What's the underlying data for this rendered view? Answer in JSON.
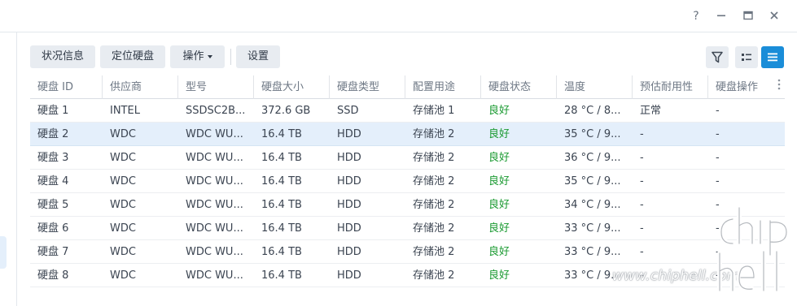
{
  "window": {
    "help_icon": "help-icon",
    "minimize_icon": "minimize-icon",
    "maximize_icon": "maximize-icon",
    "close_icon": "close-icon"
  },
  "toolbar": {
    "status_info_label": "状况信息",
    "locate_disk_label": "定位硬盘",
    "action_label": "操作",
    "settings_label": "设置",
    "filter_icon": "filter-icon",
    "detail_view_icon": "detail-view-icon",
    "list_view_icon": "list-view-icon"
  },
  "colors": {
    "accent": "#1a8dd8",
    "status_good": "#1a9a31",
    "selected_row": "#e4effb"
  },
  "table": {
    "columns": [
      "硬盘 ID",
      "供应商",
      "型号",
      "硬盘大小",
      "硬盘类型",
      "配置用途",
      "硬盘状态",
      "温度",
      "预估耐用性",
      "硬盘操作"
    ],
    "selected_row": 1,
    "rows": [
      [
        "硬盘 1",
        "INTEL",
        "SSDSC2B...",
        "372.6 GB",
        "SSD",
        "存储池 1",
        "良好",
        "28 °C / 8...",
        "正常",
        "-"
      ],
      [
        "硬盘 2",
        "WDC",
        "WDC WU...",
        "16.4 TB",
        "HDD",
        "存储池 2",
        "良好",
        "35 °C / 9...",
        "-",
        "-"
      ],
      [
        "硬盘 3",
        "WDC",
        "WDC WU...",
        "16.4 TB",
        "HDD",
        "存储池 2",
        "良好",
        "36 °C / 9...",
        "-",
        "-"
      ],
      [
        "硬盘 4",
        "WDC",
        "WDC WU...",
        "16.4 TB",
        "HDD",
        "存储池 2",
        "良好",
        "35 °C / 9...",
        "-",
        "-"
      ],
      [
        "硬盘 5",
        "WDC",
        "WDC WU...",
        "16.4 TB",
        "HDD",
        "存储池 2",
        "良好",
        "34 °C / 9...",
        "-",
        "-"
      ],
      [
        "硬盘 6",
        "WDC",
        "WDC WU...",
        "16.4 TB",
        "HDD",
        "存储池 2",
        "良好",
        "33 °C / 9...",
        "-",
        "-"
      ],
      [
        "硬盘 7",
        "WDC",
        "WDC WU...",
        "16.4 TB",
        "HDD",
        "存储池 2",
        "良好",
        "33 °C / 9...",
        "-",
        "-"
      ],
      [
        "硬盘 8",
        "WDC",
        "WDC WU...",
        "16.4 TB",
        "HDD",
        "存储池 2",
        "良好",
        "33 °C / 9...",
        "-",
        "-"
      ]
    ]
  },
  "watermark": {
    "url_text": "www.chiphell.com",
    "logo_text": "chip hell"
  }
}
